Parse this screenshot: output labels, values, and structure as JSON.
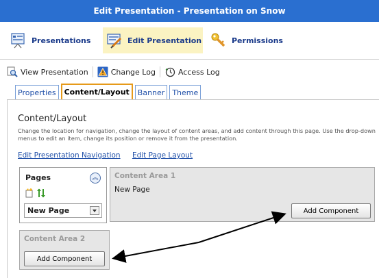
{
  "window": {
    "title": "Edit Presentation - Presentation on Snow"
  },
  "main_tabs": [
    {
      "label": "Presentations",
      "icon": "presentations-icon"
    },
    {
      "label": "Edit Presentation",
      "icon": "edit-presentation-icon",
      "active": true
    },
    {
      "label": "Permissions",
      "icon": "permissions-key-icon"
    }
  ],
  "toolbar": {
    "view": "View Presentation",
    "changelog": "Change Log",
    "access": "Access Log"
  },
  "subtabs": [
    {
      "label": "Properties"
    },
    {
      "label": "Content/Layout",
      "active": true
    },
    {
      "label": "Banner"
    },
    {
      "label": "Theme"
    }
  ],
  "content": {
    "heading": "Content/Layout",
    "description": "Change the location for navigation, change the layout of content areas, and add content through this page. Use the drop-down menus to edit an item, change its position or remove it from the presentation.",
    "link_nav": "Edit Presentation Navigation",
    "link_layout": "Edit Page Layout"
  },
  "pages": {
    "title": "Pages",
    "selected": "New Page"
  },
  "areas": {
    "area1": {
      "title": "Content Area 1",
      "content": "New Page",
      "button": "Add Component"
    },
    "area2": {
      "title": "Content Area 2",
      "button": "Add Component"
    }
  },
  "colors": {
    "titlebar": "#2a6fd0",
    "active_tab_bg": "#fbf3c2",
    "active_subtab_border": "#e69a1a",
    "link": "#1f4fa8"
  }
}
